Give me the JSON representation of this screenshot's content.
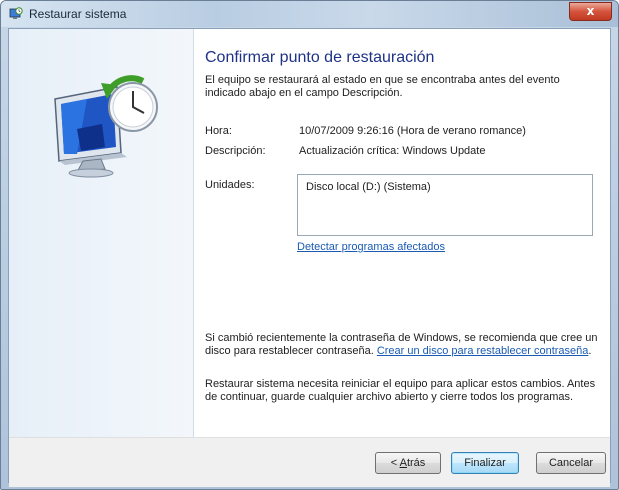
{
  "window": {
    "title": "Restaurar sistema",
    "close_glyph": "x"
  },
  "heading": "Confirmar punto de restauración",
  "intro": "El equipo se restaurará al estado en que se encontraba antes del evento indicado abajo en el campo Descripción.",
  "details": {
    "time_label": "Hora:",
    "time_value": "10/07/2009 9:26:16 (Hora de verano romance)",
    "description_label": "Descripción:",
    "description_value": "Actualización crítica: Windows Update",
    "drives_label": "Unidades:",
    "drives": [
      "Disco local (D:) (Sistema)"
    ]
  },
  "detect_link": "Detectar programas afectados",
  "password_notice": {
    "text": "Si cambió recientemente la contraseña de Windows, se recomienda que cree un disco para restablecer contraseña. ",
    "link": "Crear un disco para restablecer contraseña",
    "trailing": "."
  },
  "restart_notice": "Restaurar sistema necesita reiniciar el equipo para aplicar estos cambios. Antes de continuar, guarde cualquier archivo abierto y cierre todos los programas.",
  "buttons": {
    "back_prefix": "< ",
    "back_accel": "A",
    "back_rest": "trás",
    "finish": "Finalizar",
    "cancel": "Cancelar"
  },
  "icons": {
    "app": "system-restore-icon",
    "illustration": "monitor-restore-clock-icon",
    "close": "close-icon"
  },
  "colors": {
    "heading": "#1e3287",
    "link": "#1a5ab3",
    "close_button": "#c13a22"
  }
}
